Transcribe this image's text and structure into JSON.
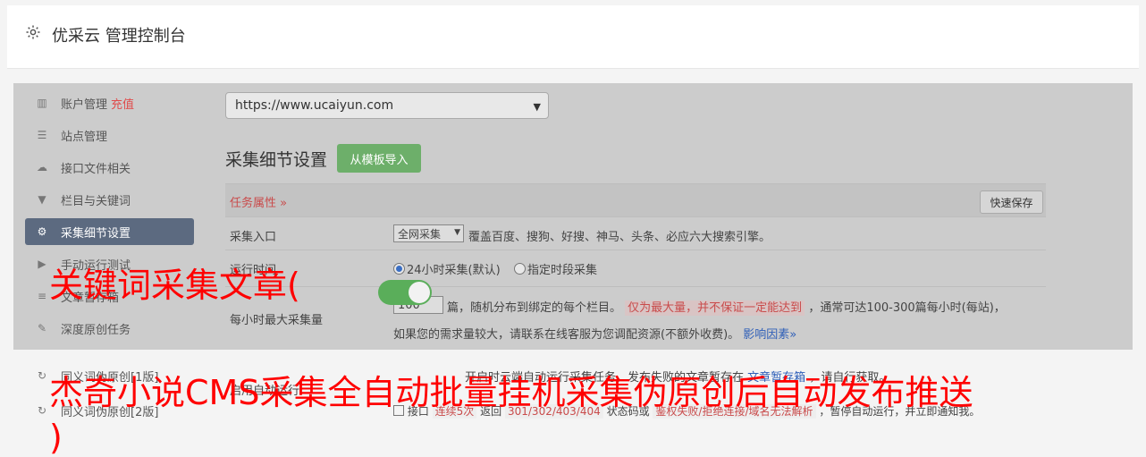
{
  "header": {
    "title": "优采云 管理控制台"
  },
  "sidebar": {
    "items": [
      {
        "label": "账户管理",
        "extra": "充值",
        "icon": "bar-chart-icon"
      },
      {
        "label": "站点管理",
        "icon": "server-icon"
      },
      {
        "label": "接口文件相关",
        "icon": "cloud-upload-icon"
      },
      {
        "label": "栏目与关键词",
        "icon": "filter-icon"
      },
      {
        "label": "采集细节设置",
        "icon": "gears-icon"
      },
      {
        "label": "手动运行测试",
        "icon": "play-icon"
      },
      {
        "label": "文章暂存箱",
        "icon": "database-icon"
      },
      {
        "label": "深度原创任务",
        "icon": "edit-icon"
      },
      {
        "label": "同义词伪原创[1版]",
        "icon": "refresh-icon"
      },
      {
        "label": "同义词伪原创[2版]",
        "icon": "refresh-icon"
      }
    ]
  },
  "main": {
    "site_select": "https://www.ucaiyun.com",
    "section_title": "采集细节设置",
    "import_button": "从模板导入",
    "task_attr": "任务属性 »",
    "quick_save": "快速保存",
    "entry": {
      "label": "采集入口",
      "select": "全网采集",
      "desc": "覆盖百度、搜狗、好搜、神马、头条、必应六大搜索引擎。"
    },
    "run_time": {
      "label": "运行时间",
      "opt1": "24小时采集(默认)",
      "opt2": "指定时段采集"
    },
    "max_per_hour": {
      "label": "每小时最大采集量",
      "value": "100",
      "text1": "篇，随机分布到绑定的每个栏目。",
      "highlight": "仅为最大量，并不保证一定能达到",
      "text2": "，通常可达100-300篇每小时(每站)，",
      "text3": "如果您的需求量较大，请联系在线客服为您调配资源(不额外收费)。",
      "link": "影响因素»"
    },
    "auto_run": {
      "label": "启用自动运行",
      "text1": "开启时云端自动运行采集任务，发布失败的文章暂存在",
      "link": "文章暂存箱",
      "text2": "，请自行获取。"
    },
    "error_line": {
      "text1": "接口",
      "red1": "连续5次",
      "text2": "返回",
      "red2": "301/302/403/404",
      "text3": "状态码或",
      "red3": "鉴权失败/拒绝连接/域名无法解析",
      "text4": "，暂停自动运行，并立即通知我。"
    }
  },
  "overlay": {
    "line1": "关键词采集文章(",
    "line2": "杰奇小说CMS采集全自动批量挂机采集伪原创后自动发布推送",
    "line3": ")"
  },
  "colors": {
    "overlay_red": "#ff0000",
    "accent_green": "#6daf6a",
    "active_sidebar": "#5c6a80"
  }
}
